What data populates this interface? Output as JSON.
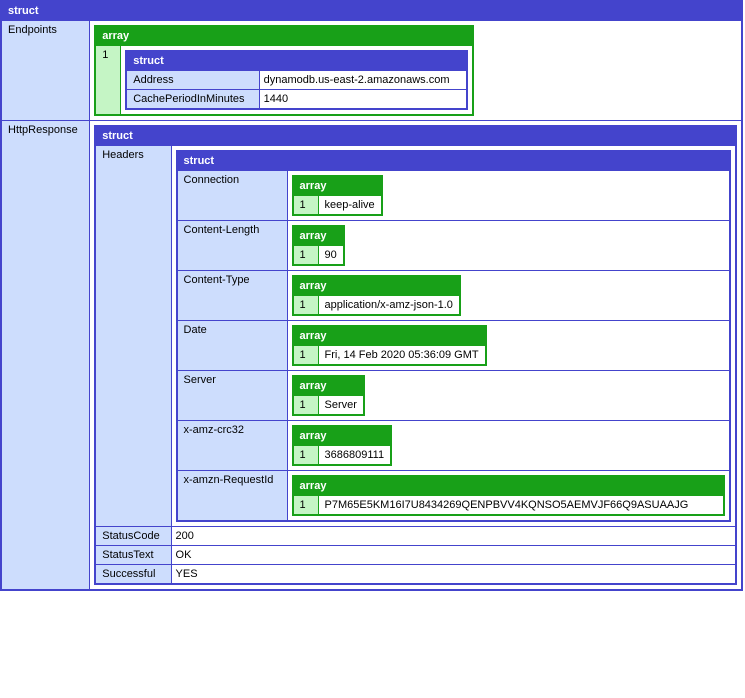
{
  "labels": {
    "struct": "struct",
    "array": "array"
  },
  "root": {
    "endpoints": {
      "key": "Endpoints",
      "idx": "1",
      "address": {
        "key": "Address",
        "val": "dynamodb.us-east-2.amazonaws.com"
      },
      "cache": {
        "key": "CachePeriodInMinutes",
        "val": "1440"
      }
    },
    "http": {
      "key": "HttpResponse",
      "headers": {
        "key": "Headers",
        "rows": {
          "connection": {
            "key": "Connection",
            "idx": "1",
            "val": "keep-alive"
          },
          "contentLength": {
            "key": "Content-Length",
            "idx": "1",
            "val": "90"
          },
          "contentType": {
            "key": "Content-Type",
            "idx": "1",
            "val": "application/x-amz-json-1.0"
          },
          "date": {
            "key": "Date",
            "idx": "1",
            "val": "Fri, 14 Feb 2020 05:36:09 GMT"
          },
          "server": {
            "key": "Server",
            "idx": "1",
            "val": "Server"
          },
          "crc": {
            "key": "x-amz-crc32",
            "idx": "1",
            "val": "3686809111"
          },
          "reqId": {
            "key": "x-amzn-RequestId",
            "idx": "1",
            "val": "P7M65E5KM16I7U8434269QENPBVV4KQNSO5AEMVJF66Q9ASUAAJG"
          }
        }
      },
      "statusCode": {
        "key": "StatusCode",
        "val": "200"
      },
      "statusText": {
        "key": "StatusText",
        "val": "OK"
      },
      "successful": {
        "key": "Successful",
        "val": "YES"
      }
    }
  }
}
